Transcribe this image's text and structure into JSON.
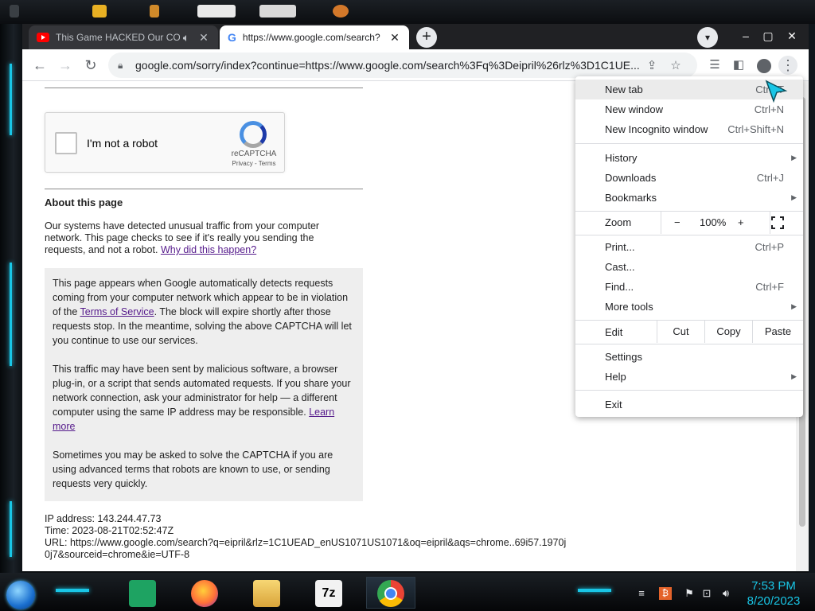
{
  "tabs": [
    {
      "title": "This Game HACKED Our COM",
      "active": false,
      "favicon": "youtube-icon",
      "audio": true
    },
    {
      "title": "https://www.google.com/search?",
      "active": true,
      "favicon": "google-icon"
    }
  ],
  "omnibox": {
    "url": "google.com/sorry/index?continue=https://www.google.com/search%3Fq%3Deipril%26rlz%3D1C1UE..."
  },
  "page": {
    "captcha": {
      "label": "I'm not a robot",
      "brand": "reCAPTCHA",
      "privacy": "Privacy",
      "separator": " - ",
      "terms": "Terms"
    },
    "about_heading": "About this page",
    "system_text": "Our systems have detected unusual traffic from your computer network. This page checks to see if it's really you sending the requests, and not a robot.",
    "why_link": "Why did this happen?",
    "gray_box": {
      "p1_a": "This page appears when Google automatically detects requests coming from your computer network which appear to be in violation of the",
      "tos_link": "Terms of Service",
      "p1_b": ". The block will expire shortly after those requests stop. In the meantime, solving the above CAPTCHA will let you continue to use our services.",
      "p2_a": "This traffic may have been sent by malicious software, a browser plug-in, or a script that sends automated requests. If you share your network connection, ask your administrator for help — a different computer using the same IP address may be responsible.",
      "learn_link": "Learn more",
      "p3": "Sometimes you may be asked to solve the CAPTCHA if you are using advanced terms that robots are known to use, or sending requests very quickly."
    },
    "ip_line": "IP address: 143.244.47.73",
    "time_line": "Time: 2023-08-21T02:52:47Z",
    "url_line": "URL: https://www.google.com/search?q=eipril&rlz=1C1UEAD_enUS1071US1071&oq=eipril&aqs=chrome..69i57.1970j0j7&sourceid=chrome&ie=UTF-8"
  },
  "menu": {
    "new_tab": {
      "label": "New tab",
      "shortcut": "Ctrl+T"
    },
    "new_window": {
      "label": "New window",
      "shortcut": "Ctrl+N"
    },
    "incognito": {
      "label": "New Incognito window",
      "shortcut": "Ctrl+Shift+N"
    },
    "history": {
      "label": "History"
    },
    "downloads": {
      "label": "Downloads",
      "shortcut": "Ctrl+J"
    },
    "bookmarks": {
      "label": "Bookmarks"
    },
    "zoom": {
      "label": "Zoom",
      "minus": "−",
      "value": "100%",
      "plus": "+"
    },
    "print": {
      "label": "Print...",
      "shortcut": "Ctrl+P"
    },
    "cast": {
      "label": "Cast..."
    },
    "find": {
      "label": "Find...",
      "shortcut": "Ctrl+F"
    },
    "more_tools": {
      "label": "More tools"
    },
    "edit": {
      "label": "Edit",
      "cut": "Cut",
      "copy": "Copy",
      "paste": "Paste"
    },
    "settings": {
      "label": "Settings"
    },
    "help": {
      "label": "Help"
    },
    "exit": {
      "label": "Exit"
    }
  },
  "taskbar": {
    "apps": [
      "start-orb-icon",
      "notes-app-icon",
      "firefox-icon",
      "file-explorer-icon",
      "7zip-icon",
      "chrome-icon"
    ],
    "clock_time": "7:53 PM",
    "clock_date": "8/20/2023"
  },
  "colors": {
    "accent_cyan": "#19c6e6",
    "link": "#551a8b",
    "tab_strip": "#202124"
  }
}
